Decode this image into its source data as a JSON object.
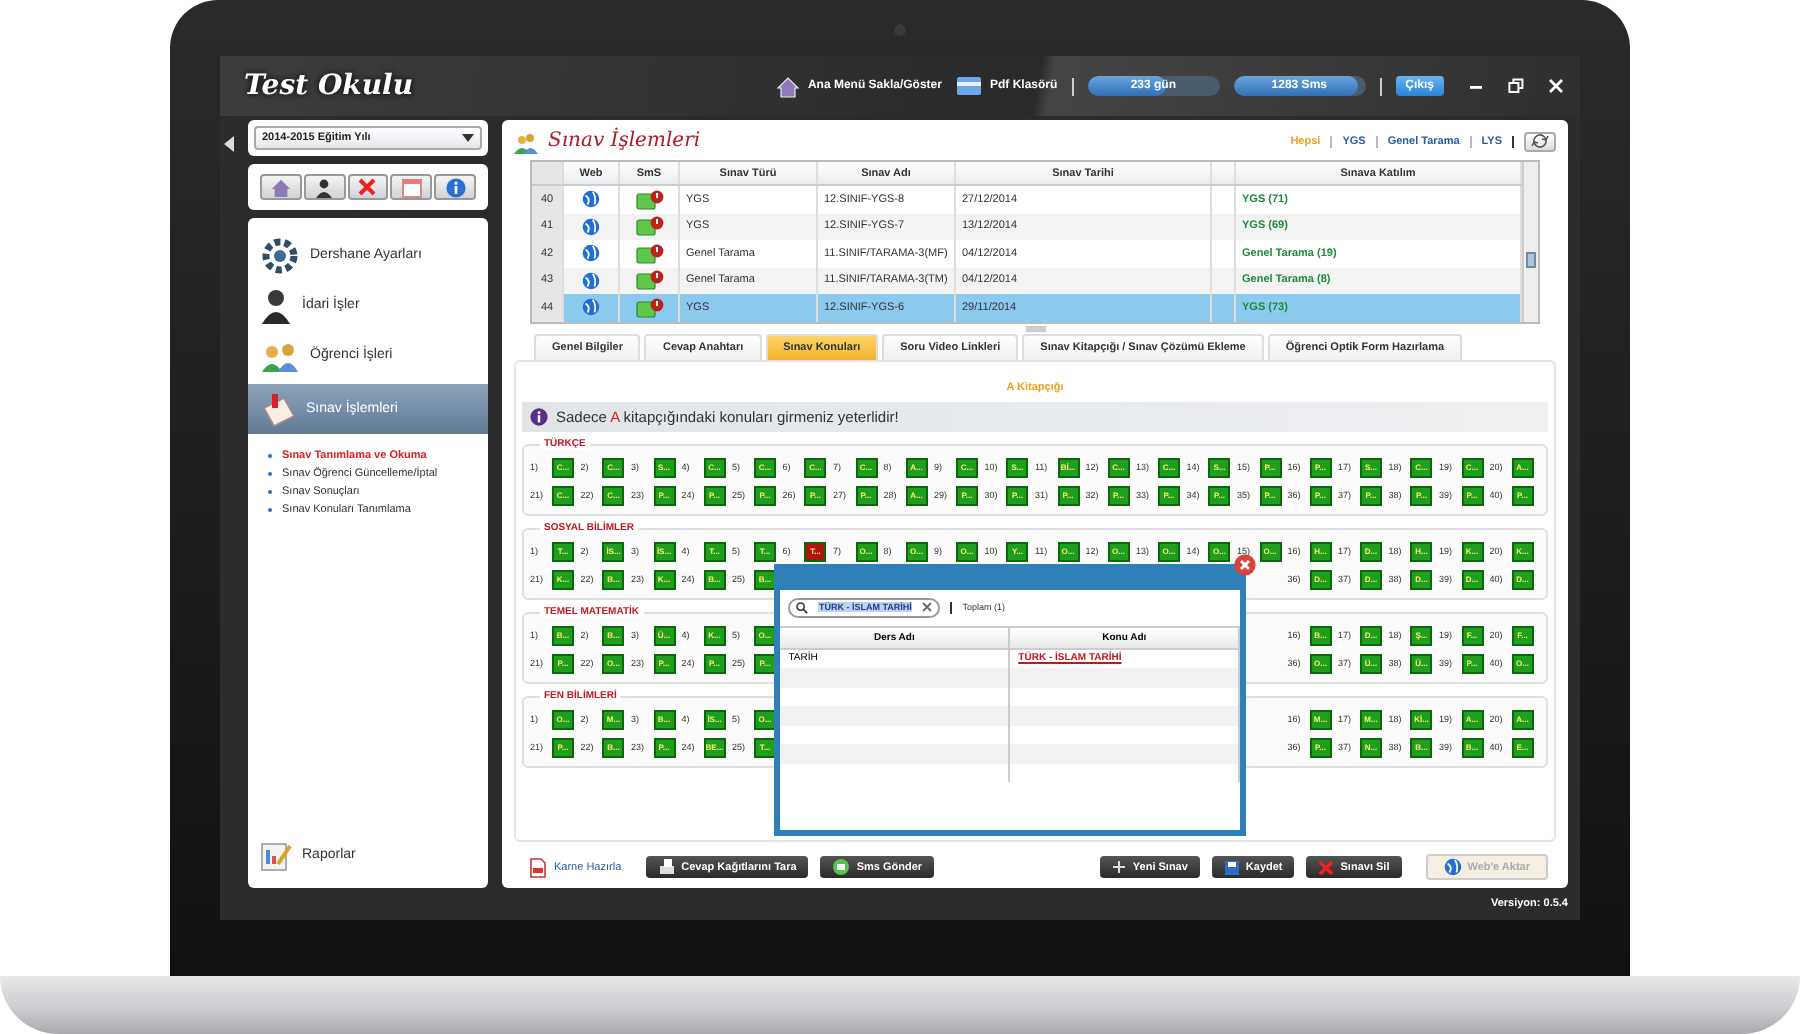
{
  "window": {
    "logo": "Test Okulu"
  },
  "top_bar": {
    "items": [
      {
        "label": "Ana Menü Sakla/Göster"
      },
      {
        "label": "Pdf Klasörü"
      }
    ],
    "meters": [
      {
        "label": "233 gün",
        "level": 0.6
      },
      {
        "label": "1283 Sms",
        "level": 0.95
      }
    ],
    "logout": "Çıkış"
  },
  "sidebar": {
    "year_select": "2014-2015 Eğitim Yılı",
    "menu": [
      {
        "label": "Dershane Ayarları",
        "selected": false
      },
      {
        "label": "İdari İşler",
        "selected": false
      },
      {
        "label": "Öğrenci İşleri",
        "selected": false
      },
      {
        "label": "Sınav İşlemleri",
        "selected": true,
        "children": [
          {
            "label": "Sınav Tanımlama ve Okuma",
            "selected": true
          },
          {
            "label": "Sınav Öğrenci Güncelleme/İptal",
            "selected": false
          },
          {
            "label": "Sınav Sonuçları",
            "selected": false
          },
          {
            "label": "Sınav Konuları Tanımlama",
            "selected": false
          }
        ]
      }
    ],
    "bottom_item": {
      "label": "Raporlar"
    }
  },
  "main": {
    "title": "Sınav İşlemleri",
    "filters": [
      {
        "label": "Hepsi",
        "selected": true
      },
      {
        "label": "YGS",
        "selected": false
      },
      {
        "label": "Genel Tarama",
        "selected": false
      },
      {
        "label": "LYS",
        "selected": false
      }
    ],
    "table": {
      "columns": [
        "Web",
        "SmS",
        "Sınav Türü",
        "Sınav Adı",
        "Sınav Tarihi",
        "Sınava Katılım"
      ],
      "rows": [
        {
          "no": "40",
          "type": "YGS",
          "name": "12.SINIF-YGS-8",
          "date": "27/12/2014",
          "participation": "YGS (71)",
          "selected": false
        },
        {
          "no": "41",
          "type": "YGS",
          "name": "12.SINIF-YGS-7",
          "date": "13/12/2014",
          "participation": "YGS (69)",
          "selected": false
        },
        {
          "no": "42",
          "type": "Genel Tarama",
          "name": "11.SINIF/TARAMA-3(MF)",
          "date": "04/12/2014",
          "participation": "Genel Tarama (19)",
          "selected": false
        },
        {
          "no": "43",
          "type": "Genel Tarama",
          "name": "11.SINIF/TARAMA-3(TM)",
          "date": "04/12/2014",
          "participation": "Genel Tarama (8)",
          "selected": false
        },
        {
          "no": "44",
          "type": "YGS",
          "name": "12.SINIF-YGS-6",
          "date": "29/11/2014",
          "participation": "YGS (73)",
          "selected": true
        }
      ]
    },
    "tabs": [
      {
        "label": "Genel Bilgiler",
        "selected": false
      },
      {
        "label": "Cevap Anahtarı",
        "selected": false
      },
      {
        "label": "Sınav Konuları",
        "selected": true
      },
      {
        "label": "Soru Video Linkleri",
        "selected": false
      },
      {
        "label": "Sınav Kitapçığı / Sınav Çözümü Ekleme",
        "selected": false
      },
      {
        "label": "Öğrenci Optik Form Hazırlama",
        "selected": false
      }
    ],
    "panel": {
      "booklet": "A Kitapçığı",
      "notice": {
        "before": "Sadece ",
        "highlight": "A",
        "after": " kitapçığındaki konuları girmeniz yeterlidir!"
      },
      "sections": [
        {
          "title": "TÜRKÇE",
          "rows": [
            {
              "items": [
                {
                  "num": "1)",
                  "label": "C...",
                  "color": "#1f9e1f"
                },
                {
                  "num": "2)",
                  "label": "C...",
                  "color": "#1f9e1f"
                },
                {
                  "num": "3)",
                  "label": "S...",
                  "color": "#1f9e1f"
                },
                {
                  "num": "4)",
                  "label": "C...",
                  "color": "#1f9e1f"
                },
                {
                  "num": "5)",
                  "label": "C...",
                  "color": "#1f9e1f"
                },
                {
                  "num": "6)",
                  "label": "C...",
                  "color": "#1f9e1f"
                },
                {
                  "num": "7)",
                  "label": "C...",
                  "color": "#1f9e1f"
                },
                {
                  "num": "8)",
                  "label": "A...",
                  "color": "#1f9e1f"
                },
                {
                  "num": "9)",
                  "label": "C...",
                  "color": "#1f9e1f"
                },
                {
                  "num": "10)",
                  "label": "S...",
                  "color": "#1f9e1f"
                },
                {
                  "num": "11)",
                  "label": "Bİ...",
                  "color": "#1f9e1f"
                },
                {
                  "num": "12)",
                  "label": "C...",
                  "color": "#1f9e1f"
                },
                {
                  "num": "13)",
                  "label": "C...",
                  "color": "#1f9e1f"
                },
                {
                  "num": "14)",
                  "label": "S...",
                  "color": "#1f9e1f"
                },
                {
                  "num": "15)",
                  "label": "P...",
                  "color": "#1f9e1f"
                },
                {
                  "num": "16)",
                  "label": "P...",
                  "color": "#1f9e1f"
                },
                {
                  "num": "17)",
                  "label": "S...",
                  "color": "#1f9e1f"
                },
                {
                  "num": "18)",
                  "label": "C...",
                  "color": "#1f9e1f"
                },
                {
                  "num": "19)",
                  "label": "C...",
                  "color": "#1f9e1f"
                },
                {
                  "num": "20)",
                  "label": "A...",
                  "color": "#1f9e1f"
                }
              ]
            },
            {
              "items": [
                {
                  "num": "21)",
                  "label": "C...",
                  "color": "#1f9e1f"
                },
                {
                  "num": "22)",
                  "label": "C...",
                  "color": "#1f9e1f"
                },
                {
                  "num": "23)",
                  "label": "P...",
                  "color": "#1f9e1f"
                },
                {
                  "num": "24)",
                  "label": "P...",
                  "color": "#1f9e1f"
                },
                {
                  "num": "25)",
                  "label": "P...",
                  "color": "#1f9e1f"
                },
                {
                  "num": "26)",
                  "label": "P...",
                  "color": "#1f9e1f"
                },
                {
                  "num": "27)",
                  "label": "P...",
                  "color": "#1f9e1f"
                },
                {
                  "num": "28)",
                  "label": "A...",
                  "color": "#1f9e1f"
                },
                {
                  "num": "29)",
                  "label": "P...",
                  "color": "#1f9e1f"
                },
                {
                  "num": "30)",
                  "label": "P...",
                  "color": "#1f9e1f"
                },
                {
                  "num": "31)",
                  "label": "P...",
                  "color": "#1f9e1f"
                },
                {
                  "num": "32)",
                  "label": "P...",
                  "color": "#1f9e1f"
                },
                {
                  "num": "33)",
                  "label": "P...",
                  "color": "#1f9e1f"
                },
                {
                  "num": "34)",
                  "label": "P...",
                  "color": "#1f9e1f"
                },
                {
                  "num": "35)",
                  "label": "P...",
                  "color": "#1f9e1f"
                },
                {
                  "num": "36)",
                  "label": "P...",
                  "color": "#1f9e1f"
                },
                {
                  "num": "37)",
                  "label": "P...",
                  "color": "#1f9e1f"
                },
                {
                  "num": "38)",
                  "label": "P...",
                  "color": "#1f9e1f"
                },
                {
                  "num": "39)",
                  "label": "P...",
                  "color": "#1f9e1f"
                },
                {
                  "num": "40)",
                  "label": "P...",
                  "color": "#1f9e1f"
                }
              ]
            }
          ]
        },
        {
          "title": "SOSYAL BİLİMLER",
          "rows": [
            {
              "items": [
                {
                  "num": "1)",
                  "label": "T...",
                  "color": "#1f9e1f"
                },
                {
                  "num": "2)",
                  "label": "İS...",
                  "color": "#1f9e1f"
                },
                {
                  "num": "3)",
                  "label": "İS...",
                  "color": "#1f9e1f"
                },
                {
                  "num": "4)",
                  "label": "T...",
                  "color": "#1f9e1f"
                },
                {
                  "num": "5)",
                  "label": "T...",
                  "color": "#1f9e1f"
                },
                {
                  "num": "6)",
                  "label": "T...",
                  "color": "#b3140f"
                },
                {
                  "num": "7)",
                  "label": "O...",
                  "color": "#1f9e1f"
                },
                {
                  "num": "8)",
                  "label": "O...",
                  "color": "#1f9e1f"
                },
                {
                  "num": "9)",
                  "label": "O...",
                  "color": "#1f9e1f"
                },
                {
                  "num": "10)",
                  "label": "Y...",
                  "color": "#1f9e1f"
                },
                {
                  "num": "11)",
                  "label": "O...",
                  "color": "#1f9e1f"
                },
                {
                  "num": "12)",
                  "label": "O...",
                  "color": "#1f9e1f"
                },
                {
                  "num": "13)",
                  "label": "O...",
                  "color": "#1f9e1f"
                },
                {
                  "num": "14)",
                  "label": "O...",
                  "color": "#1f9e1f"
                },
                {
                  "num": "15)",
                  "label": "O...",
                  "color": "#1f9e1f"
                },
                {
                  "num": "16)",
                  "label": "H...",
                  "color": "#1f9e1f"
                },
                {
                  "num": "17)",
                  "label": "D...",
                  "color": "#1f9e1f"
                },
                {
                  "num": "18)",
                  "label": "H...",
                  "color": "#1f9e1f"
                },
                {
                  "num": "19)",
                  "label": "K...",
                  "color": "#1f9e1f"
                },
                {
                  "num": "20)",
                  "label": "K...",
                  "color": "#1f9e1f"
                }
              ]
            },
            {
              "items": [
                {
                  "num": "21)",
                  "label": "K...",
                  "color": "#1f9e1f"
                },
                {
                  "num": "22)",
                  "label": "B...",
                  "color": "#1f9e1f"
                },
                {
                  "num": "23)",
                  "label": "K...",
                  "color": "#1f9e1f"
                },
                {
                  "num": "24)",
                  "label": "B...",
                  "color": "#1f9e1f"
                },
                {
                  "num": "25)",
                  "label": "B...",
                  "color": "#1f9e1f"
                },
                {
                  "num": "36)",
                  "label": "D...",
                  "color": "#1f9e1f"
                },
                {
                  "num": "37)",
                  "label": "D...",
                  "color": "#1f9e1f"
                },
                {
                  "num": "38)",
                  "label": "D...",
                  "color": "#1f9e1f"
                },
                {
                  "num": "39)",
                  "label": "D...",
                  "color": "#1f9e1f"
                },
                {
                  "num": "40)",
                  "label": "D...",
                  "color": "#1f9e1f"
                }
              ]
            }
          ]
        },
        {
          "title": "TEMEL MATEMATİK",
          "rows": [
            {
              "items": [
                {
                  "num": "1)",
                  "label": "B...",
                  "color": "#1f9e1f"
                },
                {
                  "num": "2)",
                  "label": "B...",
                  "color": "#1f9e1f"
                },
                {
                  "num": "3)",
                  "label": "Ü...",
                  "color": "#1f9e1f"
                },
                {
                  "num": "4)",
                  "label": "K...",
                  "color": "#1f9e1f"
                },
                {
                  "num": "5)",
                  "label": "O...",
                  "color": "#1f9e1f"
                },
                {
                  "num": "16)",
                  "label": "B...",
                  "color": "#1f9e1f"
                },
                {
                  "num": "17)",
                  "label": "D...",
                  "color": "#1f9e1f"
                },
                {
                  "num": "18)",
                  "label": "Ş...",
                  "color": "#1f9e1f"
                },
                {
                  "num": "19)",
                  "label": "F...",
                  "color": "#1f9e1f"
                },
                {
                  "num": "20)",
                  "label": "F...",
                  "color": "#1f9e1f"
                }
              ]
            },
            {
              "items": [
                {
                  "num": "21)",
                  "label": "P...",
                  "color": "#1f9e1f"
                },
                {
                  "num": "22)",
                  "label": "O...",
                  "color": "#1f9e1f"
                },
                {
                  "num": "23)",
                  "label": "P...",
                  "color": "#1f9e1f"
                },
                {
                  "num": "24)",
                  "label": "P...",
                  "color": "#1f9e1f"
                },
                {
                  "num": "25)",
                  "label": "P...",
                  "color": "#1f9e1f"
                },
                {
                  "num": "36)",
                  "label": "O...",
                  "color": "#1f9e1f"
                },
                {
                  "num": "37)",
                  "label": "Ü...",
                  "color": "#1f9e1f"
                },
                {
                  "num": "38)",
                  "label": "Ü...",
                  "color": "#1f9e1f"
                },
                {
                  "num": "39)",
                  "label": "P...",
                  "color": "#1f9e1f"
                },
                {
                  "num": "40)",
                  "label": "O...",
                  "color": "#1f9e1f"
                }
              ]
            }
          ]
        },
        {
          "title": "FEN BİLİMLERİ",
          "rows": [
            {
              "items": [
                {
                  "num": "1)",
                  "label": "O...",
                  "color": "#1f9e1f"
                },
                {
                  "num": "2)",
                  "label": "M...",
                  "color": "#1f9e1f"
                },
                {
                  "num": "3)",
                  "label": "B...",
                  "color": "#1f9e1f"
                },
                {
                  "num": "4)",
                  "label": "İS...",
                  "color": "#1f9e1f"
                },
                {
                  "num": "5)",
                  "label": "O...",
                  "color": "#1f9e1f"
                },
                {
                  "num": "16)",
                  "label": "M...",
                  "color": "#1f9e1f"
                },
                {
                  "num": "17)",
                  "label": "M...",
                  "color": "#1f9e1f"
                },
                {
                  "num": "18)",
                  "label": "Kİ...",
                  "color": "#1f9e1f"
                },
                {
                  "num": "19)",
                  "label": "A...",
                  "color": "#1f9e1f"
                },
                {
                  "num": "20)",
                  "label": "A...",
                  "color": "#1f9e1f"
                }
              ]
            },
            {
              "items": [
                {
                  "num": "21)",
                  "label": "P...",
                  "color": "#1f9e1f"
                },
                {
                  "num": "22)",
                  "label": "B...",
                  "color": "#1f9e1f"
                },
                {
                  "num": "23)",
                  "label": "P...",
                  "color": "#1f9e1f"
                },
                {
                  "num": "24)",
                  "label": "BE...",
                  "color": "#1f9e1f"
                },
                {
                  "num": "25)",
                  "label": "T...",
                  "color": "#1f9e1f"
                },
                {
                  "num": "36)",
                  "label": "P...",
                  "color": "#1f9e1f"
                },
                {
                  "num": "37)",
                  "label": "N...",
                  "color": "#1f9e1f"
                },
                {
                  "num": "38)",
                  "label": "B...",
                  "color": "#1f9e1f"
                },
                {
                  "num": "39)",
                  "label": "B...",
                  "color": "#1f9e1f"
                },
                {
                  "num": "40)",
                  "label": "E...",
                  "color": "#1f9e1f"
                }
              ]
            }
          ]
        }
      ]
    },
    "dialog": {
      "search": {
        "value": "TÜRK - İSLAM TARİHİ"
      },
      "total": "Toplam (1)",
      "columns": [
        "Ders Adı",
        "Konu Adı"
      ],
      "rows": [
        {
          "lesson": "TARİH",
          "topic": "TÜRK - İSLAM TARİHİ"
        }
      ]
    },
    "actions": {
      "report_link": "Karne Hazırla",
      "left_buttons": [
        {
          "label": "Cevap Kağıtlarını Tara"
        },
        {
          "label": "Sms Gönder"
        }
      ],
      "right_buttons": [
        {
          "label": "Yeni Sınav"
        },
        {
          "label": "Kaydet"
        },
        {
          "label": "Sınavı Sil"
        }
      ],
      "web_button": {
        "label": "Web'e Aktar",
        "disabled": true
      }
    }
  },
  "footer": {
    "version": "Versiyon: 0.5.4"
  }
}
